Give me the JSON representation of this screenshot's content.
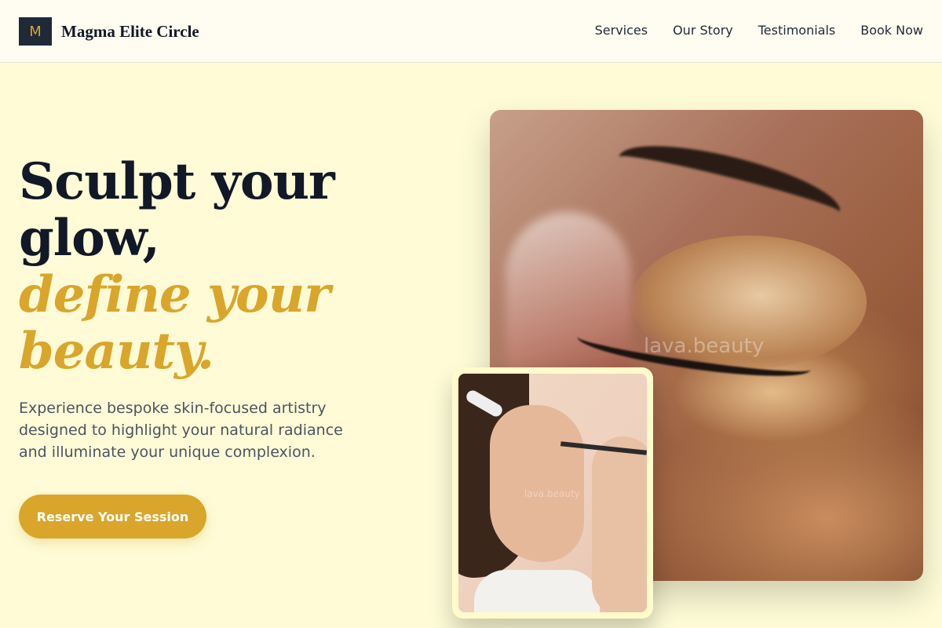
{
  "header": {
    "logo_letter": "M",
    "brand_name": "Magma Elite Circle",
    "nav": [
      "Services",
      "Our Story",
      "Testimonials",
      "Book Now"
    ]
  },
  "hero": {
    "headline_line1": "Sculpt your",
    "headline_line2": "glow,",
    "headline_accent_line1": "define your",
    "headline_accent_line2": "beauty.",
    "intro": "Experience bespoke skin-focused artistry designed to highlight your natural radiance and illuminate your unique complexion.",
    "cta_label": "Reserve Your Session"
  },
  "images": {
    "main_photo_watermark": "lava.beauty",
    "inset_photo_watermark": "lava.beauty"
  },
  "colors": {
    "background": "#fefbd6",
    "accent": "#d9a62b",
    "dark": "#111827"
  }
}
